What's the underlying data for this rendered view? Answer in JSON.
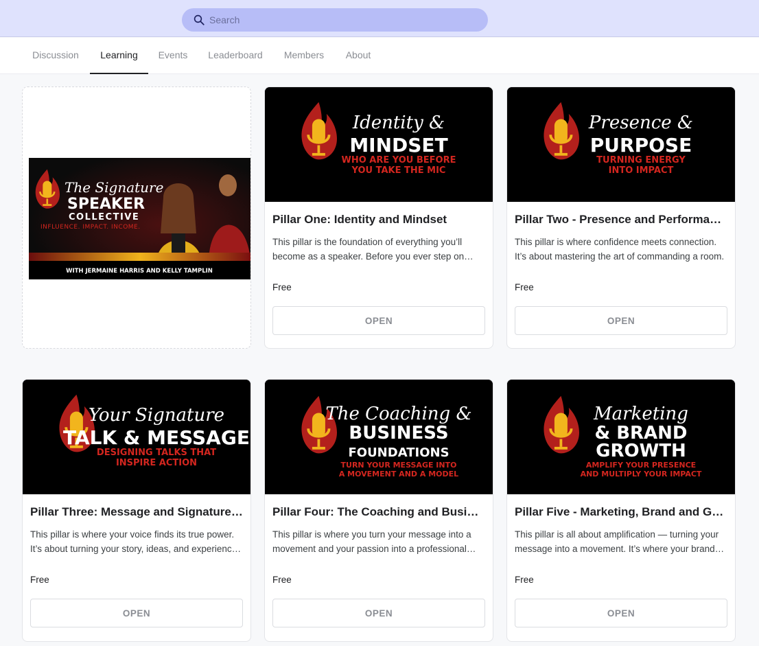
{
  "search": {
    "placeholder": "Search"
  },
  "tabs": [
    {
      "label": "Discussion",
      "active": false
    },
    {
      "label": "Learning",
      "active": true
    },
    {
      "label": "Events",
      "active": false
    },
    {
      "label": "Leaderboard",
      "active": false
    },
    {
      "label": "Members",
      "active": false
    },
    {
      "label": "About",
      "active": false
    }
  ],
  "promo": {
    "script": "The Signature",
    "word1": "SPEAKER",
    "word2": "COLLECTIVE",
    "tagline": "INFLUENCE. IMPACT. INCOME.",
    "byline": "WITH JERMAINE HARRIS AND KELLY TAMPLIN"
  },
  "courses": [
    {
      "title": "Pillar One: Identity and Mindset",
      "description": "This pillar is the foundation of everything you’ll become as a speaker. Before you ever step on stage, you have to know who you are.",
      "price": "Free",
      "button": "OPEN",
      "banner": {
        "script": "Identity &",
        "big1": "MINDSET",
        "big2": "",
        "sub1": "WHO ARE YOU BEFORE",
        "sub2": "YOU TAKE THE MIC"
      }
    },
    {
      "title": "Pillar Two - Presence and Performance",
      "description": "This pillar is where confidence meets connection. It’s about mastering the art of commanding a room.",
      "price": "Free",
      "button": "OPEN",
      "banner": {
        "script": "Presence &",
        "big1": "PURPOSE",
        "big2": "",
        "sub1": "TURNING ENERGY",
        "sub2": "INTO IMPACT"
      }
    },
    {
      "title": "Pillar Three: Message and Signature Talk",
      "description": "This pillar is where your voice finds its true power. It’s about turning your story, ideas, and experience into a talk.",
      "price": "Free",
      "button": "OPEN",
      "banner": {
        "script": "Your Signature",
        "big1": "TALK & MESSAGE",
        "big2": "",
        "sub1": "DESIGNING TALKS THAT",
        "sub2": "INSPIRE ACTION"
      }
    },
    {
      "title": "Pillar Four: The Coaching and Business Foundations",
      "description": "This pillar is where you turn your message into a movement and your passion into a professional business.",
      "price": "Free",
      "button": "OPEN",
      "banner": {
        "script": "The Coaching &",
        "big1": "BUSINESS",
        "big2": "FOUNDATIONS",
        "sub1": "TURN YOUR MESSAGE INTO",
        "sub2": "A MOVEMENT AND A MODEL"
      }
    },
    {
      "title": "Pillar Five - Marketing, Brand and Growth",
      "description": "This pillar is all about amplification — turning your message into a movement. It’s where your brand grows.",
      "price": "Free",
      "button": "OPEN",
      "banner": {
        "script": "Marketing",
        "big1": "& BRAND",
        "big2": "GROWTH",
        "sub1": "AMPLIFY YOUR PRESENCE",
        "sub2": "AND MULTIPLY YOUR IMPACT"
      }
    }
  ],
  "colors": {
    "topbar": "#dfe2fd",
    "search": "#b7bdf7",
    "flame_red": "#b3201c",
    "mic_yellow": "#f2b51d",
    "sub_red": "#d3261f"
  }
}
